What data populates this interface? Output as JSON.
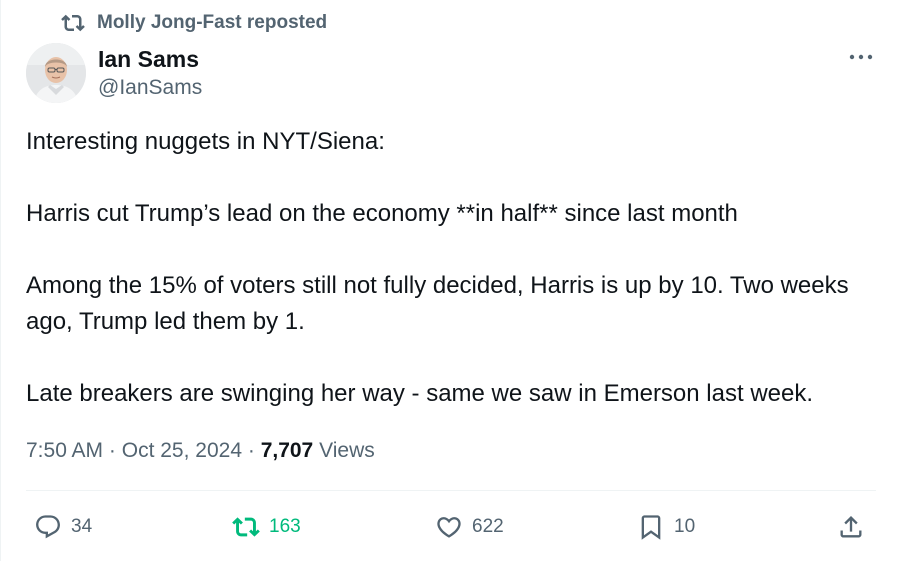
{
  "repost": {
    "text": "Molly Jong-Fast reposted",
    "icon": "repost-icon"
  },
  "author": {
    "name": "Ian Sams",
    "handle": "@IanSams"
  },
  "tweet": {
    "paragraphs": [
      "Interesting nuggets in NYT/Siena:",
      "Harris cut Trump’s lead on the economy **in half** since last month",
      "Among the 15% of voters still not fully decided, Harris is up by 10. Two weeks ago, Trump led them by 1.",
      "Late breakers are swinging her way - same we saw in Emerson last week."
    ]
  },
  "meta": {
    "time": "7:50 AM",
    "sep1": "·",
    "date": "Oct 25, 2024",
    "sep2": "·",
    "views_count": "7,707",
    "views_label": "Views"
  },
  "actions": {
    "replies": "34",
    "reposts": "163",
    "likes": "622",
    "bookmarks": "10"
  },
  "colors": {
    "text": "#0f1419",
    "secondary": "#536471",
    "repost_active": "#00ba7c",
    "divider": "#eff3f4"
  }
}
